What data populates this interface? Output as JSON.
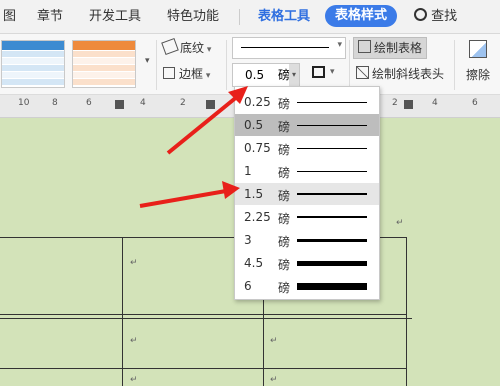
{
  "menubar": {
    "items": [
      "图",
      "章节",
      "开发工具",
      "特色功能"
    ],
    "active_tab": "表格工具",
    "pill_tab": "表格样式",
    "search": "查找"
  },
  "ribbon": {
    "shading": "底纹",
    "border": "边框",
    "draw_table": "绘制表格",
    "draw_diagonal": "绘制斜线表头",
    "erase": "擦除",
    "line_width_value": "0.5",
    "line_width_unit": "磅"
  },
  "ruler": {
    "ticks": [
      "10",
      "8",
      "6",
      "4",
      "2",
      "2",
      "4",
      "6"
    ]
  },
  "dropdown": {
    "options": [
      {
        "value": "0.25",
        "unit": "磅",
        "thickness": 0.25,
        "selected": false,
        "hovered": false
      },
      {
        "value": "0.5",
        "unit": "磅",
        "thickness": 0.5,
        "selected": true,
        "hovered": false
      },
      {
        "value": "0.75",
        "unit": "磅",
        "thickness": 0.75,
        "selected": false,
        "hovered": false
      },
      {
        "value": "1",
        "unit": "磅",
        "thickness": 1,
        "selected": false,
        "hovered": false
      },
      {
        "value": "1.5",
        "unit": "磅",
        "thickness": 1.5,
        "selected": false,
        "hovered": true
      },
      {
        "value": "2.25",
        "unit": "磅",
        "thickness": 2.25,
        "selected": false,
        "hovered": false
      },
      {
        "value": "3",
        "unit": "磅",
        "thickness": 3,
        "selected": false,
        "hovered": false
      },
      {
        "value": "4.5",
        "unit": "磅",
        "thickness": 4.5,
        "selected": false,
        "hovered": false
      },
      {
        "value": "6",
        "unit": "磅",
        "thickness": 6,
        "selected": false,
        "hovered": false
      }
    ]
  },
  "document": {
    "return_mark": "↵"
  },
  "colors": {
    "accent": "#3b7be8",
    "arrow": "#e8201a",
    "doc_bg": "#d3e3b9"
  }
}
